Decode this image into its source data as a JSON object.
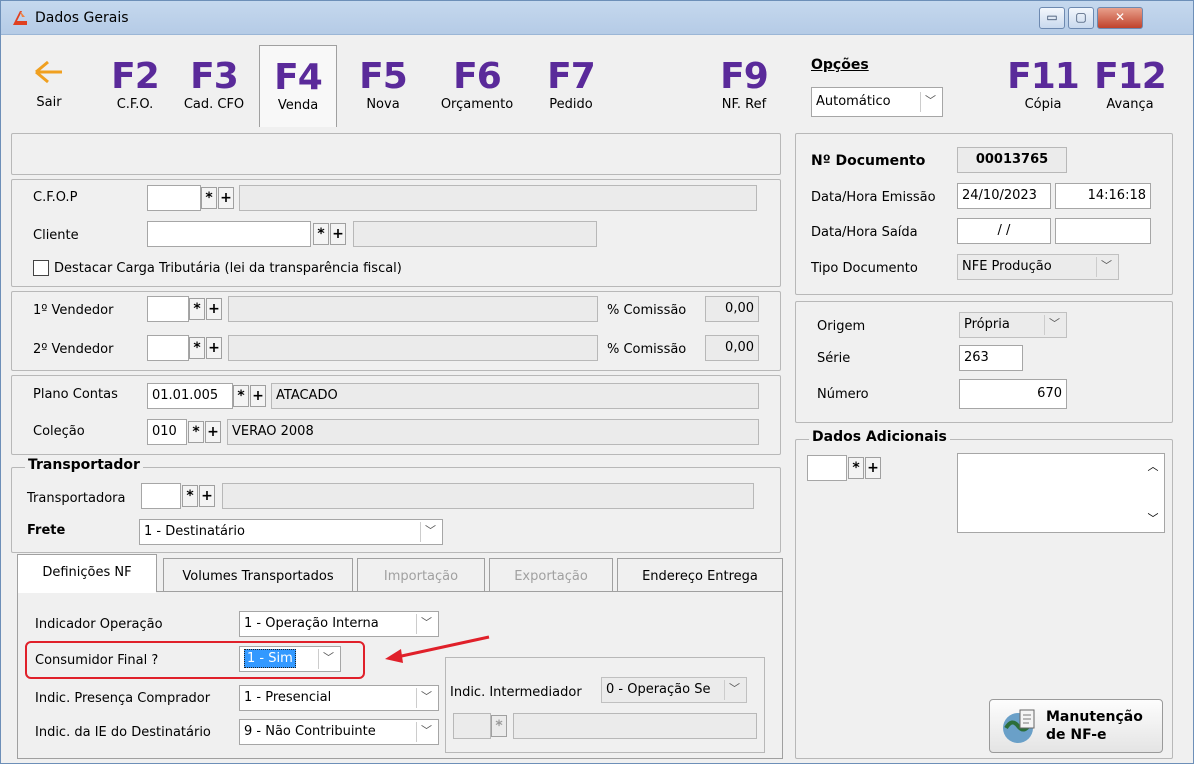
{
  "window": {
    "title": "Dados Gerais",
    "min": "▭",
    "max": "▢",
    "close": "✕"
  },
  "toolbar": {
    "sair": "Sair",
    "buttons": [
      {
        "key": "F2",
        "label": "C.F.O."
      },
      {
        "key": "F3",
        "label": "Cad. CFO"
      },
      {
        "key": "F4",
        "label": "Venda"
      },
      {
        "key": "F5",
        "label": "Nova"
      },
      {
        "key": "F6",
        "label": "Orçamento"
      },
      {
        "key": "F7",
        "label": "Pedido"
      },
      {
        "key": "F9",
        "label": "NF. Ref"
      },
      {
        "key": "F11",
        "label": "Cópia"
      },
      {
        "key": "F12",
        "label": "Avança"
      }
    ],
    "opcoes_label": "Opções",
    "opcoes_value": "Automático"
  },
  "form": {
    "cfop_label": "C.F.O.P",
    "cliente_label": "Cliente",
    "destacar_label": "Destacar Carga Tributária (lei da transparência fiscal)",
    "vendedor1_label": "1º Vendedor",
    "vendedor2_label": "2º Vendedor",
    "comissao_label": "% Comissão",
    "comissao1": "0,00",
    "comissao2": "0,00",
    "plano_label": "Plano Contas",
    "plano_code": "01.01.005",
    "plano_desc": "ATACADO",
    "colecao_label": "Coleção",
    "colecao_code": "010",
    "colecao_desc": "VERAO 2008",
    "transportador_title": "Transportador",
    "transportadora_label": "Transportadora",
    "frete_label": "Frete",
    "frete_value": "1 - Destinatário",
    "star": "*",
    "plus": "+"
  },
  "tabs": [
    "Definições NF",
    "Volumes Transportados",
    "Importação",
    "Exportação",
    "Endereço Entrega"
  ],
  "definicoes": {
    "indicador_label": "Indicador Operação",
    "indicador_value": "1 - Operação Interna",
    "consumidor_label": "Consumidor Final ?",
    "consumidor_value": "1 - Sim",
    "presenca_label": "Indic. Presença Comprador",
    "presenca_value": "1 - Presencial",
    "ie_label": "Indic. da IE do Destinatário",
    "ie_value": "9 - Não Contribuinte",
    "intermediador_label": "Indic. Intermediador",
    "intermediador_value": "0 - Operação Se"
  },
  "documento": {
    "num_label": "Nº Documento",
    "num_value": "00013765",
    "emissao_label": "Data/Hora Emissão",
    "emissao_date": "24/10/2023",
    "emissao_time": "14:16:18",
    "saida_label": "Data/Hora Saída",
    "saida_date": "/ /",
    "tipo_label": "Tipo Documento",
    "tipo_value": "NFE Produção"
  },
  "origem": {
    "origem_label": "Origem",
    "origem_value": "Própria",
    "serie_label": "Série",
    "serie_value": "263",
    "numero_label": "Número",
    "numero_value": "670"
  },
  "adicionais": {
    "title": "Dados Adicionais"
  },
  "manutencao": {
    "line1": "Manutenção",
    "line2": "de NF-e"
  }
}
